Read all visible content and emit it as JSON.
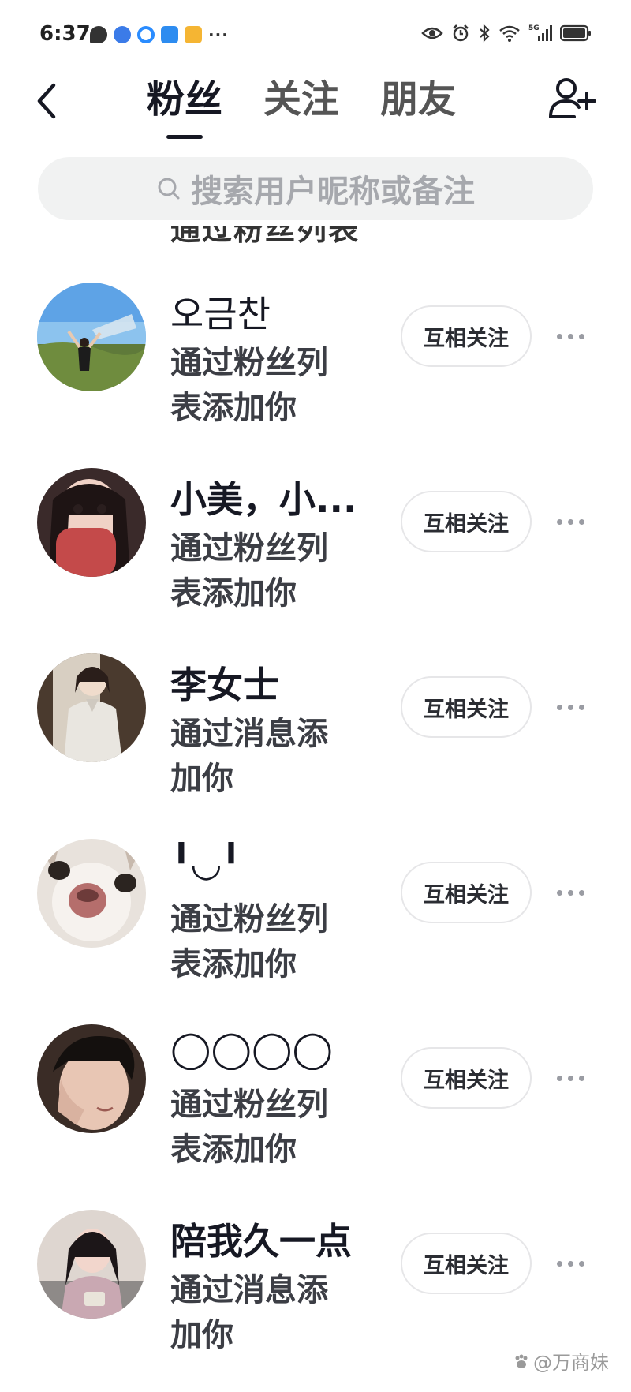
{
  "status_bar": {
    "time": "6:37",
    "more_notifications": "···"
  },
  "header": {
    "tabs": [
      {
        "label": "粉丝",
        "active": true
      },
      {
        "label": "关注",
        "active": false
      },
      {
        "label": "朋友",
        "active": false
      }
    ]
  },
  "search": {
    "placeholder": "搜索用户昵称或备注"
  },
  "cut_off_row_text": "通过粉丝列表",
  "followers": [
    {
      "name": "오금찬",
      "desc": "通过粉丝列表添加你",
      "button": "互相关注"
    },
    {
      "name": "小美，小...",
      "desc": "通过粉丝列表添加你",
      "button": "互相关注"
    },
    {
      "name": "李女士",
      "desc": "通过消息添加你",
      "button": "互相关注"
    },
    {
      "name": "╹◡╹",
      "desc": "通过粉丝列表添加你",
      "button": "互相关注"
    },
    {
      "name": "◯◯◯◯",
      "desc": "通过粉丝列表添加你",
      "button": "互相关注"
    },
    {
      "name": "陪我久一点",
      "desc": "通过消息添加你",
      "button": "互相关注"
    }
  ],
  "watermark": "@万商妹",
  "colors": {
    "text_primary": "#161823",
    "text_secondary": "#3c3e45",
    "search_bg": "#f1f2f2",
    "button_border": "#e6e6e8"
  }
}
